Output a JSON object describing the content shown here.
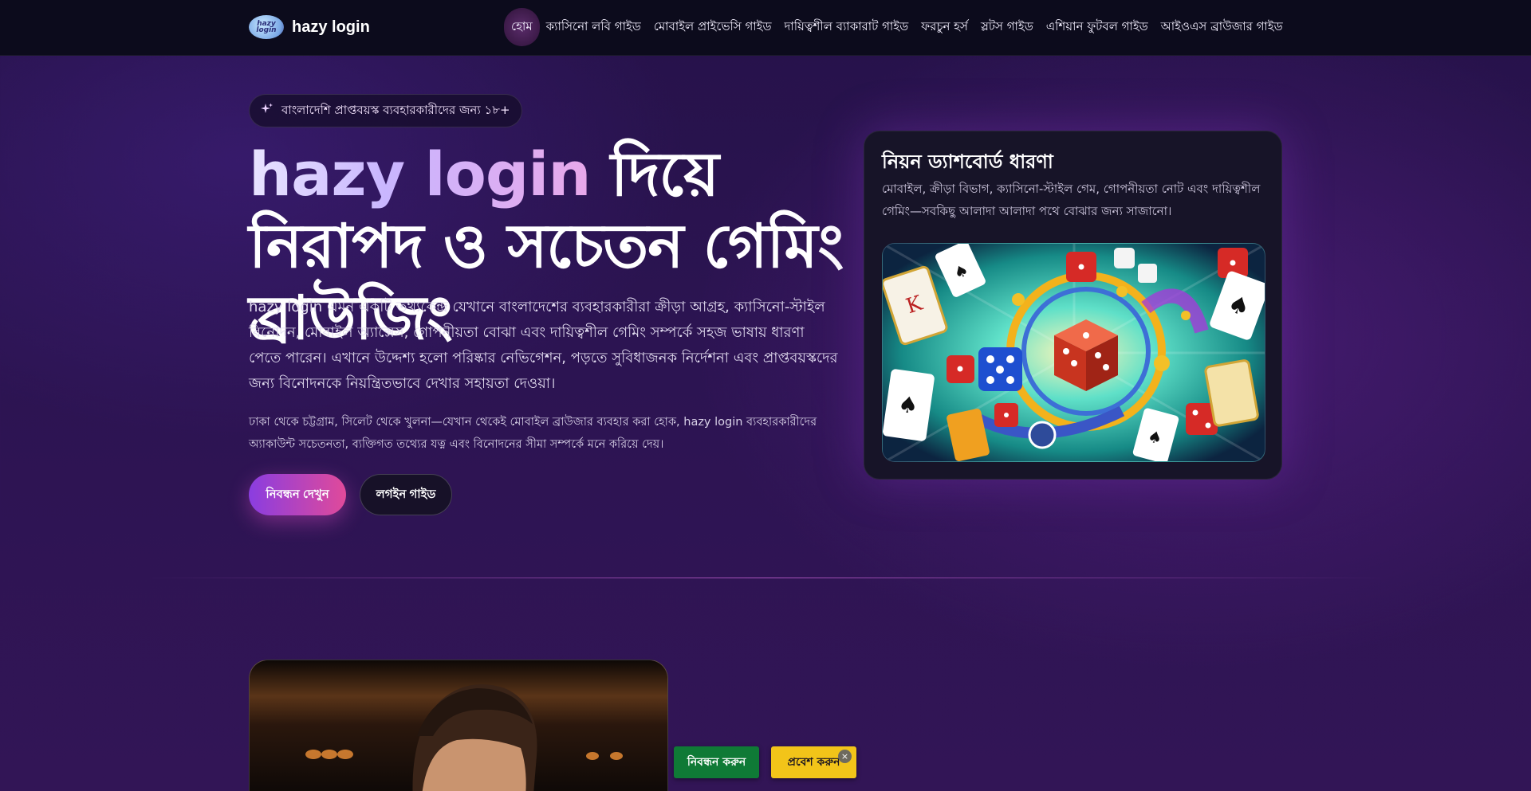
{
  "header": {
    "logo_text": "hazy login",
    "brand_name": "hazy login",
    "nav": [
      "হোম",
      "ক্যাসিনো লবি গাইড",
      "মোবাইল প্রাইভেসি গাইড",
      "দায়িত্বশীল ব্যাকারাট গাইড",
      "ফরচুন হর্স",
      "স্লটস গাইড",
      "এশিয়ান ফুটবল গাইড",
      "আইওএস ব্রাউজার গাইড"
    ],
    "active_index": 0
  },
  "hero": {
    "badge_icon": "sparkle-icon",
    "badge": "বাংলাদেশি প্রাপ্তবয়স্ক ব্যবহারকারীদের জন্য ১৮+",
    "title_highlight": "hazy login",
    "title_rest": " দিয়ে নিরাপদ ও সচেতন গেমিং ব্রাউজিং",
    "lead": "hazy login এমন একটি তথ্যকেন্দ্র যেখানে বাংলাদেশের ব্যবহারকারীরা ক্রীড়া আগ্রহ, ক্যাসিনো-স্টাইল বিনোদন, মোবাইল অ্যাক্সেস, গোপনীয়তা বোঝা এবং দায়িত্বশীল গেমিং সম্পর্কে সহজ ভাষায় ধারণা পেতে পারেন। এখানে উদ্দেশ্য হলো পরিষ্কার নেভিগেশন, পড়তে সুবিধাজনক নির্দেশনা এবং প্রাপ্তবয়স্কদের জন্য বিনোদনকে নিয়ন্ত্রিতভাবে দেখার সহায়তা দেওয়া।",
    "lead2": "ঢাকা থেকে চট্টগ্রাম, সিলেট থেকে খুলনা—যেখান থেকেই মোবাইল ব্রাউজার ব্যবহার করা হোক, hazy login ব্যবহারকারীদের অ্যাকাউন্ট সচেতনতা, ব্যক্তিগত তথ্যের যত্ন এবং বিনোদনের সীমা সম্পর্কে মনে করিয়ে দেয়।",
    "primary_button": "নিবন্ধন দেখুন",
    "secondary_button": "লগইন গাইড"
  },
  "card": {
    "title": "নিয়ন ড্যাশবোর্ড ধারণা",
    "text": "মোবাইল, ক্রীড়া বিভাগ, ক্যাসিনো-স্টাইল গেম, গোপনীয়তা নোট এবং দায়িত্বশীল গেমিং—সবকিছু আলাদা আলাদা পথে বোঝার জন্য সাজানো।"
  },
  "sticky": {
    "register": "নিবন্ধন করুন",
    "login": "প্রবেশ করুন",
    "close": "×"
  }
}
